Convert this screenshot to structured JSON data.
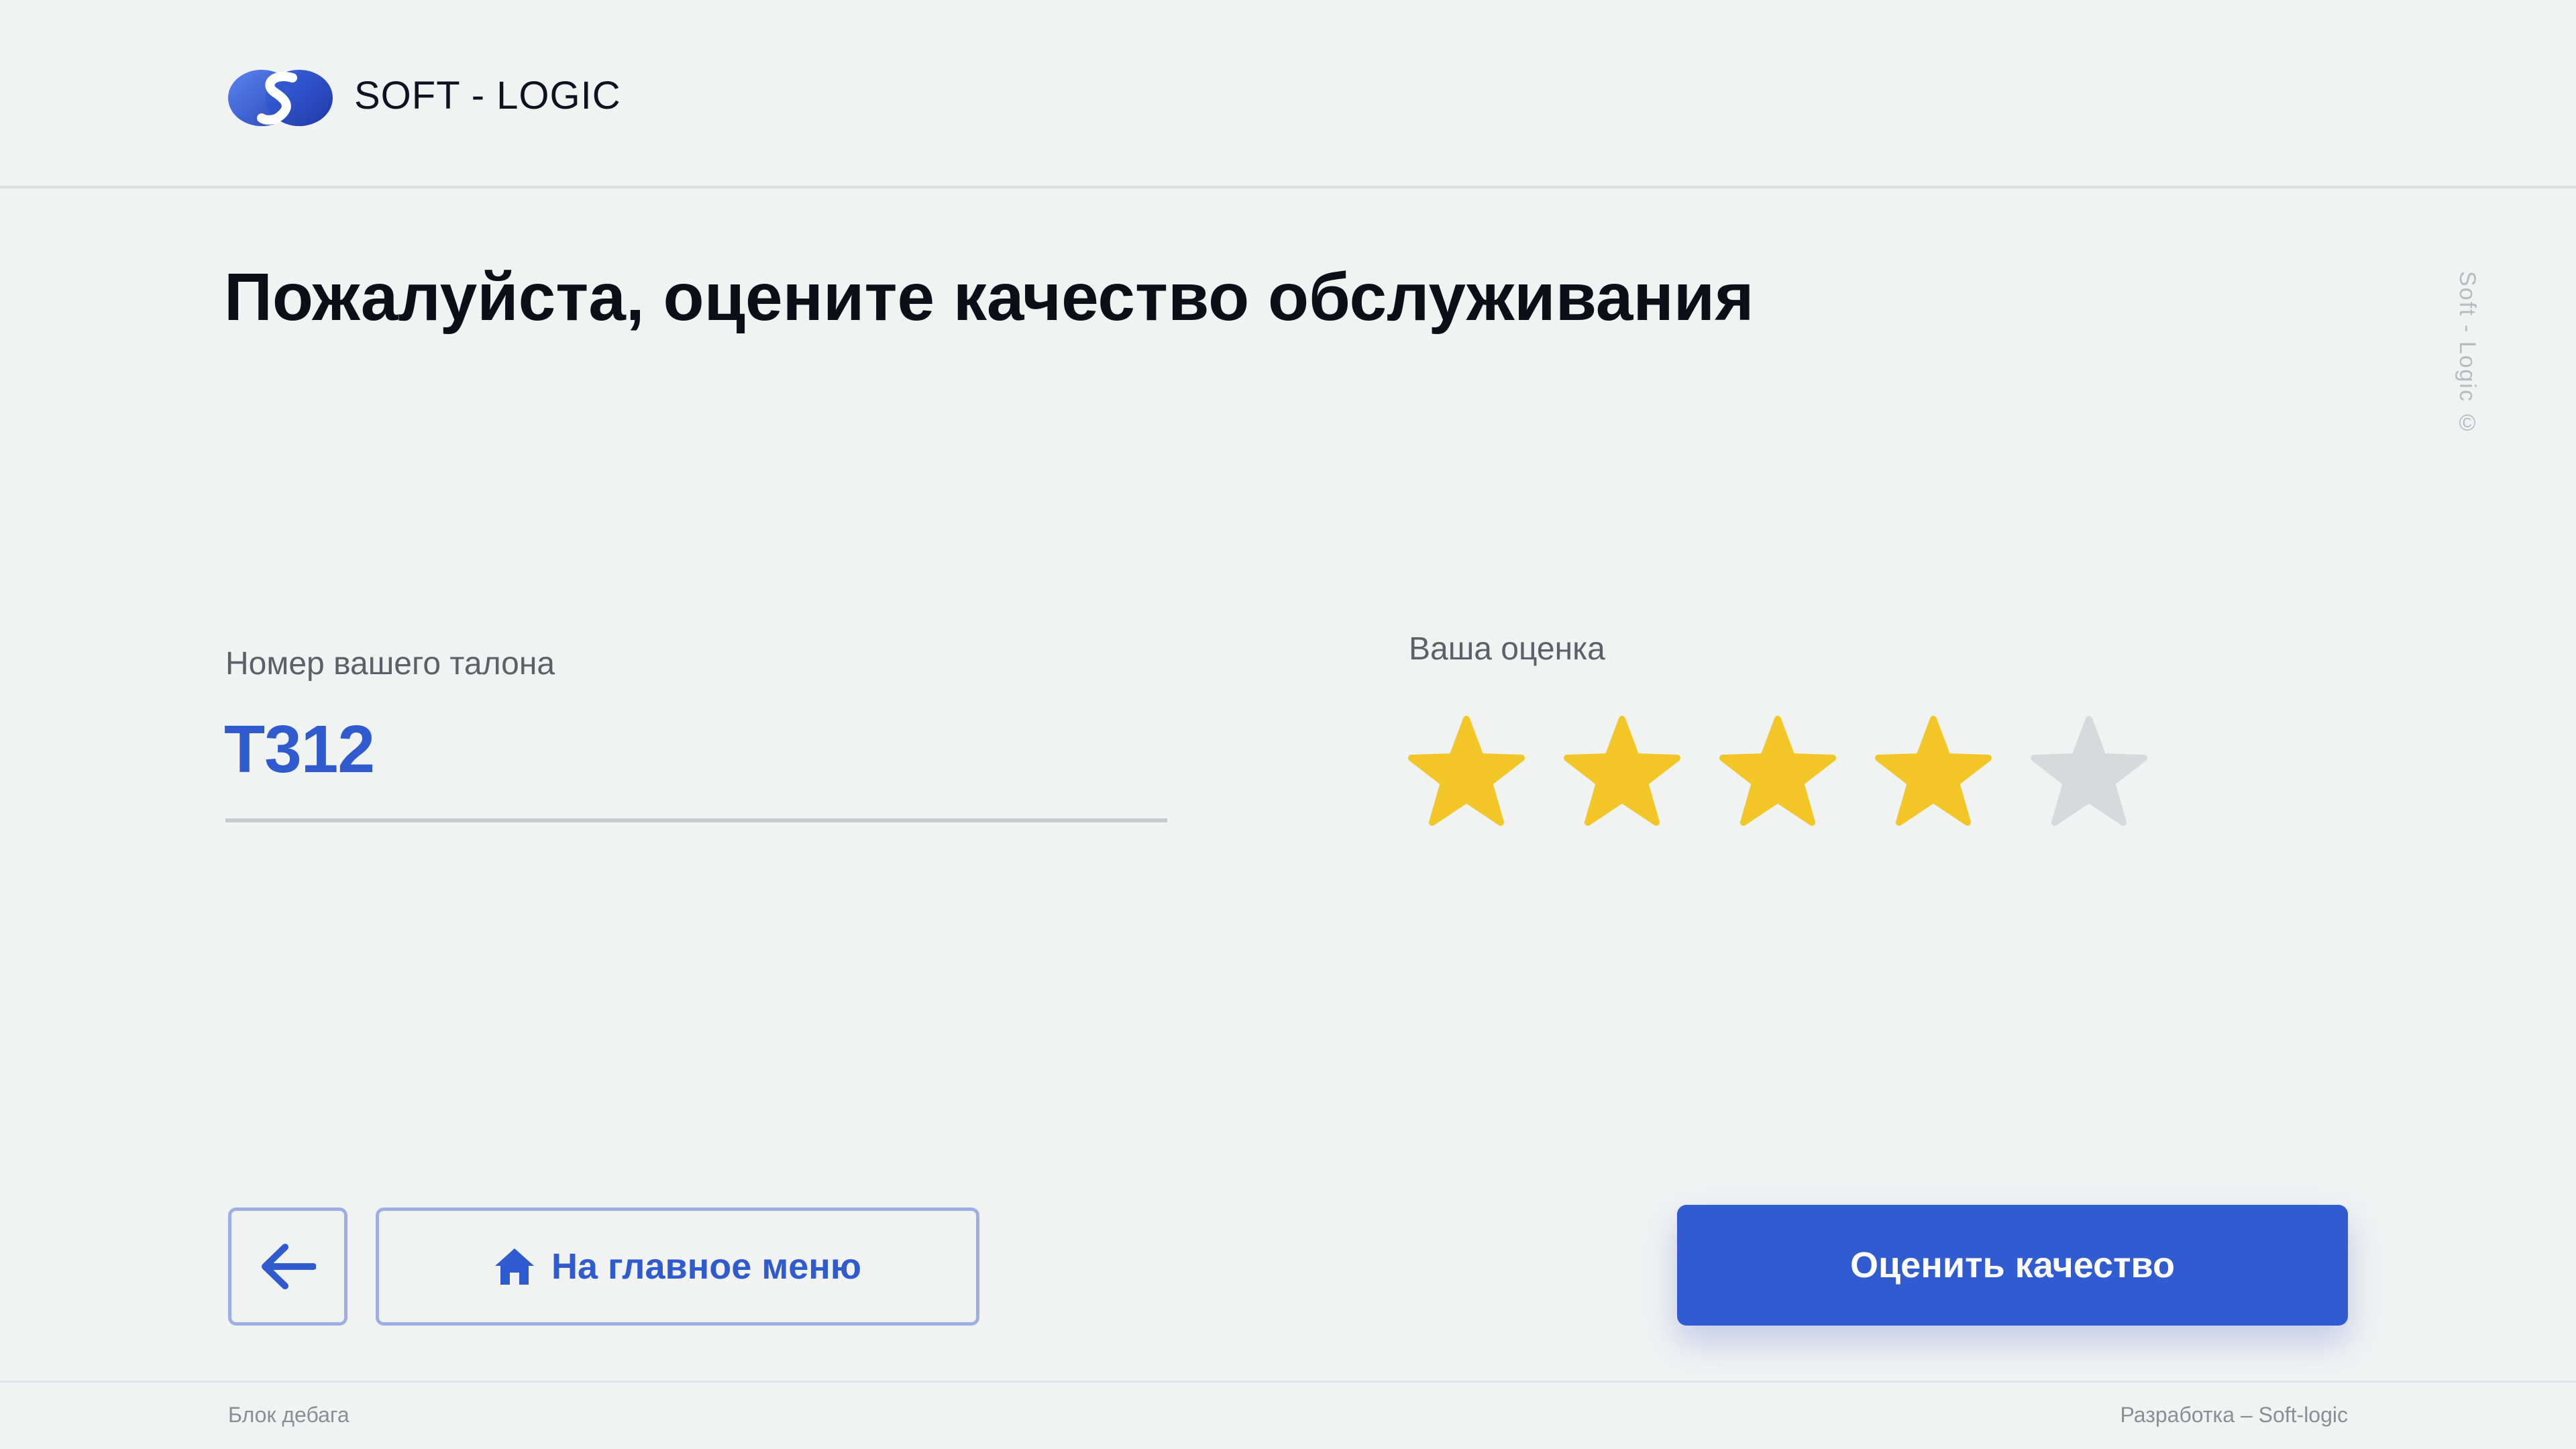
{
  "header": {
    "logo_text": "SOFT - LOGIC"
  },
  "main": {
    "title": "Пожалуйста, оцените качество обслуживания",
    "watermark": "Soft - Logic ©",
    "ticket": {
      "label": "Номер вашего талона",
      "number": "Т312"
    },
    "rating": {
      "label": "Ваша оценка",
      "value": 4,
      "max": 5
    }
  },
  "actions": {
    "back_icon": "arrow-left-icon",
    "home_icon": "home-icon",
    "home_label": "На главное меню",
    "rate_label": "Оценить качество"
  },
  "footer": {
    "left": "Блок дебага",
    "right": "Разработка – Soft-logic"
  },
  "colors": {
    "accent": "#305bd1",
    "star_active": "#f2c626",
    "star_inactive": "#d8d9db",
    "background": "#f1f2f2"
  }
}
